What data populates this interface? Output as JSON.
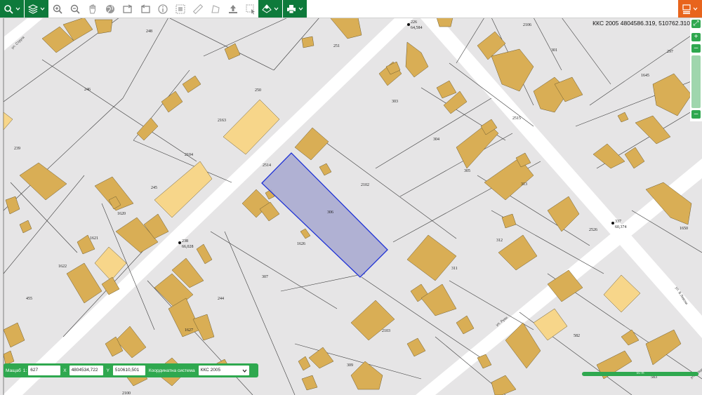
{
  "toolbar": {
    "buttons": [
      {
        "name": "search-menu-button",
        "icon": "search-icon"
      },
      {
        "name": "layers-menu-button",
        "icon": "layers-icon"
      },
      {
        "name": "zoom-in-button",
        "icon": "zoom-in-icon"
      },
      {
        "name": "zoom-out-button",
        "icon": "zoom-out-icon"
      },
      {
        "name": "pan-button",
        "icon": "hand-icon"
      },
      {
        "name": "full-extent-button",
        "icon": "globe-icon"
      },
      {
        "name": "previous-extent-button",
        "icon": "previous-extent-icon"
      },
      {
        "name": "next-extent-button",
        "icon": "next-extent-icon"
      },
      {
        "name": "identify-button",
        "icon": "info-icon"
      },
      {
        "name": "measure-area-button",
        "icon": "area-measure-icon"
      },
      {
        "name": "measure-distance-button",
        "icon": "ruler-icon"
      },
      {
        "name": "polygon-tool-button",
        "icon": "polygon-icon"
      },
      {
        "name": "upload-button",
        "icon": "upload-icon"
      },
      {
        "name": "select-button",
        "icon": "select-icon"
      },
      {
        "name": "location-menu-button",
        "icon": "location-layers-icon"
      },
      {
        "name": "print-menu-button",
        "icon": "printer-icon"
      },
      {
        "name": "user-menu-button",
        "icon": "user-menu-icon"
      }
    ]
  },
  "coordinates_readout": "ККС 2005 4804586.319, 510762.310",
  "bottom_bar": {
    "scale_label": "Мащаб",
    "scale_prefix": "1:",
    "scale_value": "627",
    "x_label": "X",
    "x_value": "4804534,722",
    "y_label": "Y",
    "y_value": "510610,501",
    "crs_label": "Координатна система",
    "crs_value": "ККС 2005"
  },
  "scale_bar_text": "50 m",
  "map": {
    "colors": {
      "background": "#e6e5e6",
      "road": "#ffffff",
      "building_fill": "#d9ae55",
      "building_light": "#f7d68a",
      "selected_fill": "#aaabd0",
      "selected_stroke": "#1f32d6",
      "parcel_line": "#3b3b3b"
    },
    "parcel_labels": [
      "248",
      "251",
      "2106",
      "301",
      "297",
      "246",
      "250",
      "303",
      "1645",
      "2163",
      "2515",
      "239",
      "2104",
      "304",
      "2514",
      "2102",
      "305",
      "313",
      "245",
      "306",
      "1620",
      "2526",
      "1650",
      "312",
      "1621",
      "1626",
      "311",
      "1622",
      "307",
      "455",
      "244",
      "1627",
      "2103",
      "582",
      "309",
      "2100",
      "583"
    ],
    "street_names": [
      "ул. Струга",
      "ул. Руен",
      "ул. В.Левски",
      "ул. Средна"
    ],
    "spot_heights": [
      {
        "id": "226",
        "elev": "64,584"
      },
      {
        "id": "238",
        "elev": "66,028"
      },
      {
        "id": "337",
        "elev": "60,374"
      }
    ]
  }
}
